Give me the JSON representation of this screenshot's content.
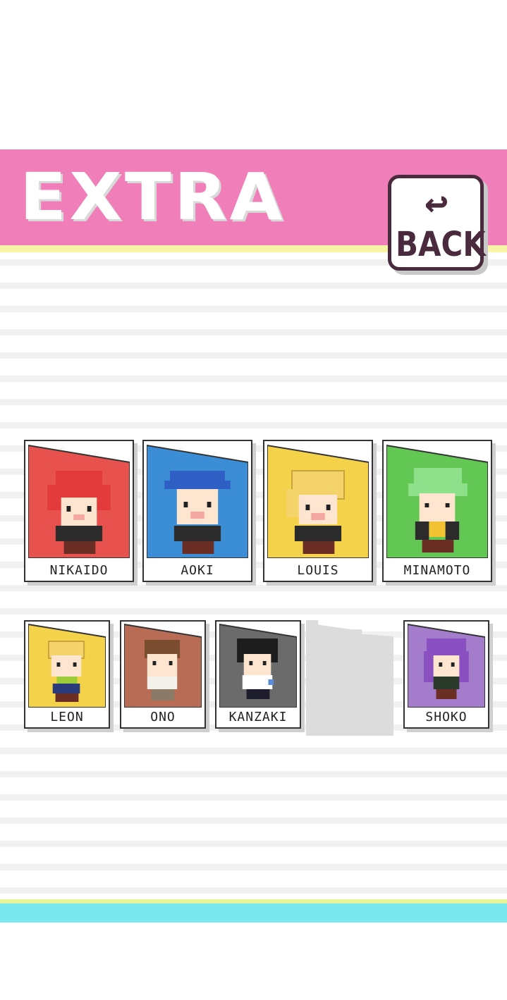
{
  "screen": {
    "title": "EXTRA"
  },
  "back_button": {
    "label": "BACK",
    "icon": "return-arrow-icon"
  },
  "colors": {
    "header": "#f07fb9",
    "header_stripe": "#f8f6a6",
    "bottom_stripe_yellow": "#e4f59a",
    "bottom_stripe_cyan": "#7ae9ef",
    "outline": "#4a2b3d"
  },
  "characters": [
    {
      "name": "NIKAIDO",
      "color": "#e8524e",
      "hair": "#e33b3b"
    },
    {
      "name": "AOKI",
      "color": "#3b8ed6",
      "hair": "#2f5fc4"
    },
    {
      "name": "LOUIS",
      "color": "#f4d24a",
      "hair": "#f3d36a"
    },
    {
      "name": "MINAMOTO",
      "color": "#63c754",
      "hair": "#8fe08a"
    },
    {
      "name": "LEON",
      "color": "#f4d24a",
      "hair": "#f3d36a"
    },
    {
      "name": "ONO",
      "color": "#b96c55",
      "hair": "#7a4d30"
    },
    {
      "name": "KANZAKI",
      "color": "#6b6b6b",
      "hair": "#1d1d1d"
    },
    {
      "name": "",
      "locked": true
    },
    {
      "name": "SHOKO",
      "color": "#a37ccc",
      "hair": "#8a4fc0"
    }
  ]
}
